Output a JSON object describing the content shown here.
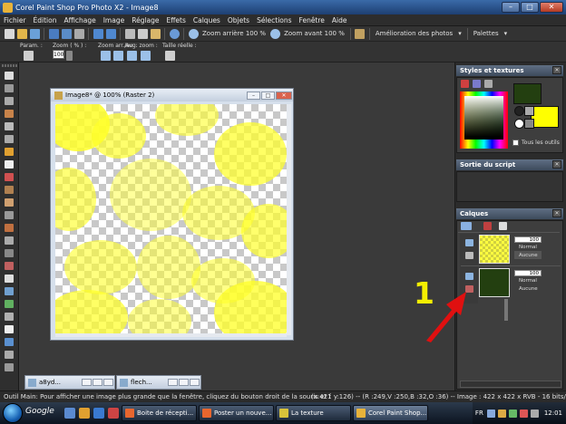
{
  "window": {
    "title": "Corel Paint Shop Pro Photo X2 - Image8",
    "minimize_glyph": "–",
    "maximize_glyph": "□",
    "close_glyph": "✕"
  },
  "menu": [
    "Fichier",
    "Édition",
    "Affichage",
    "Image",
    "Réglage",
    "Effets",
    "Calques",
    "Objets",
    "Sélections",
    "Fenêtre",
    "Aide"
  ],
  "toolbar": {
    "zoom_out_label": "Zoom arrière 100 %",
    "zoom_in_label": "Zoom avant 100 %",
    "enhance_label": "Amélioration des photos",
    "palettes_label": "Palettes",
    "dropdown_glyph": "▾"
  },
  "tool_options": {
    "param_label": "Param. :",
    "zoom_label": "Zoom ( % ) :",
    "zoom_value": "100",
    "zoom_prev_next_label": "Zoom arr./av. :",
    "aug_zoom_label": "Aug. zoom :",
    "actual_size_label": "Taille réelle :"
  },
  "image_window": {
    "title": "Image8* @ 100% (Raster 2)"
  },
  "minimized_windows": [
    {
      "title": "a8yd..."
    },
    {
      "title": "flech..."
    }
  ],
  "styles_panel": {
    "title": "Styles et textures",
    "all_tools_label": "Tous les outils",
    "foreground_color": "#233f10",
    "background_color": "#ffff00"
  },
  "script_panel": {
    "title": "Sortie du script"
  },
  "layers_panel": {
    "title": "Calques",
    "layers": [
      {
        "opacity": "100",
        "blend": "Normal",
        "lock": "Aucune",
        "thumb": "yellow-checker"
      },
      {
        "opacity": "100",
        "blend": "Normal",
        "lock": "Aucune",
        "thumb": "dark-green"
      }
    ]
  },
  "annotation": {
    "number": "1",
    "number_color": "#f5ef00",
    "arrow_color": "#e01010"
  },
  "statusbar": {
    "hint": "Outil Main: Pour afficher une image plus grande que la fenêtre, cliquez du bouton droit de la souris et f",
    "info": "(x:421 y:126) -- (R :249,V :250,B :32,O :36) -- Image : 422 x 422 x RVB - 16 bits/canal"
  },
  "taskbar": {
    "google_label": "Google",
    "tasks": [
      {
        "label": "Boite de récepti...",
        "icon_color": "#e8662e"
      },
      {
        "label": "Poster un nouve...",
        "icon_color": "#e8662e"
      },
      {
        "label": "La texture",
        "icon_color": "#d8c23a"
      },
      {
        "label": "Corel Paint Shop...",
        "icon_color": "#e8b33a"
      }
    ],
    "language": "FR",
    "clock": "12:01"
  }
}
